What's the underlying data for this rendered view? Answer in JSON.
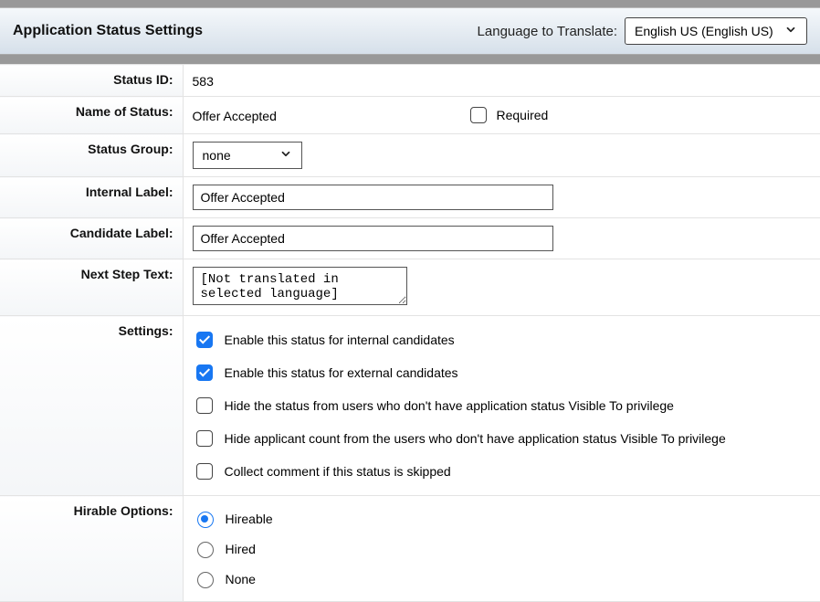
{
  "header": {
    "title": "Application Status Settings",
    "language_label": "Language to Translate:",
    "language_value": "English US (English US)"
  },
  "labels": {
    "status_id": "Status ID:",
    "name_of_status": "Name of Status:",
    "status_group": "Status Group:",
    "internal_label": "Internal Label:",
    "candidate_label": "Candidate Label:",
    "next_step_text": "Next Step Text:",
    "settings": "Settings:",
    "hirable_options": "Hirable Options:"
  },
  "fields": {
    "status_id": "583",
    "name_of_status": "Offer Accepted",
    "required_label": "Required",
    "status_group_value": "none",
    "internal_label_value": "Offer Accepted",
    "candidate_label_value": "Offer Accepted",
    "next_step_text_value": "[Not translated in selected language]"
  },
  "settings": {
    "enable_internal": "Enable this status for internal candidates",
    "enable_external": "Enable this status for external candidates",
    "hide_status": "Hide the status from users who don't have application status Visible To privilege",
    "hide_count": "Hide applicant count from the users who don't have application status Visible To privilege",
    "collect_comment": "Collect comment if this status is skipped"
  },
  "hirable": {
    "hireable": "Hireable",
    "hired": "Hired",
    "none": "None"
  }
}
